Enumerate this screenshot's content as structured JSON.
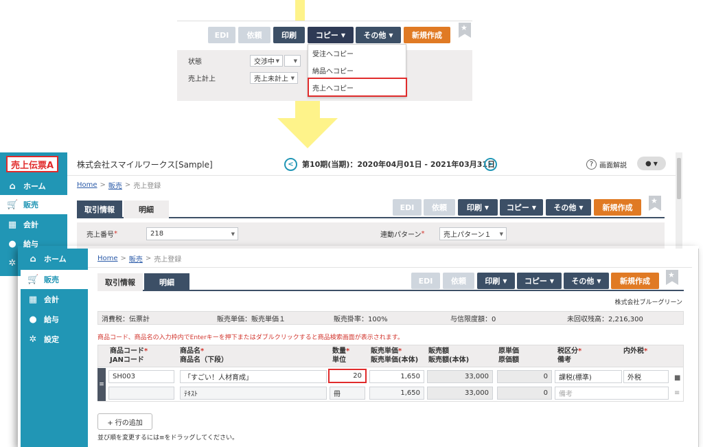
{
  "top_panel": {
    "buttons": {
      "edi": "EDI",
      "irai": "依頼",
      "print": "印刷",
      "copy": "コピー",
      "other": "その他",
      "new": "新規作成"
    },
    "status_label": "状態",
    "status_value": "交渉中",
    "sales_label": "売上計上",
    "sales_value": "売上未計上",
    "dropdown": [
      "受注へコピー",
      "納品へコピー",
      "売上へコピー"
    ]
  },
  "colors": {
    "accent_red": "#e02b2b",
    "arrow_yellow": "#fef38a",
    "sidebar": "#2196b5",
    "orange": "#e07a24",
    "navy": "#3c4f66"
  },
  "window1": {
    "badge": "売上伝票A",
    "company": "株式会社スマイルワークス[Sample]",
    "period": "第10期(当期)：2020年04月01日 - 2021年03月31日",
    "help": "画面解説",
    "breadcrumb": {
      "home": "Home",
      "sep": ">",
      "sales": "販売",
      "page": "売上登録"
    },
    "tabs": [
      "取引情報",
      "明細"
    ],
    "buttons": {
      "edi": "EDI",
      "irai": "依頼",
      "print": "印刷",
      "copy": "コピー",
      "other": "その他",
      "new": "新規作成"
    },
    "number_label": "売上番号",
    "number_value": "218",
    "pattern_label": "連動パターン",
    "pattern_value": "売上パターン１",
    "nav": [
      {
        "label": "ホーム",
        "icon": "home-icon"
      },
      {
        "label": "販売",
        "icon": "cart-icon"
      },
      {
        "label": "会計",
        "icon": "calculator-icon"
      },
      {
        "label": "給与",
        "icon": "money-bag-icon"
      },
      {
        "label": "設定",
        "icon": "gear-icon"
      }
    ]
  },
  "window2": {
    "nav": [
      {
        "label": "ホーム",
        "icon": "home-icon"
      },
      {
        "label": "販売",
        "icon": "cart-icon"
      },
      {
        "label": "会計",
        "icon": "calculator-icon"
      },
      {
        "label": "給与",
        "icon": "money-bag-icon"
      },
      {
        "label": "設定",
        "icon": "gear-icon"
      }
    ],
    "breadcrumb": {
      "home": "Home",
      "sep": ">",
      "sales": "販売",
      "page": "売上登録"
    },
    "tabs": [
      "取引情報",
      "明細"
    ],
    "buttons": {
      "edi": "EDI",
      "irai": "依頼",
      "print": "印刷",
      "copy": "コピー",
      "other": "その他",
      "new": "新規作成"
    },
    "customer": "株式会社ブルーグリーン",
    "info": {
      "tax": "消費税：伝票計",
      "price": "販売単価：販売単価１",
      "rate": "販売掛率：100%",
      "credit": "与信限度額：0",
      "balance": "未回収残高：2,216,300"
    },
    "notice": "商品コード、商品名の入力枠内でEnterキーを押下またはダブルクリックすると商品検索画面が表示されます。",
    "headers": {
      "code": "商品コード",
      "jan": "JANコード",
      "name": "商品名",
      "name2": "商品名（下段）",
      "qty": "数量",
      "unit": "単位",
      "price": "販売単価",
      "price2": "販売単価(本体)",
      "amount": "販売額",
      "amount2": "販売額(本体)",
      "cost": "原単価",
      "cost2": "原価額",
      "taxcls": "税区分",
      "memo": "備考",
      "inout": "内外税"
    },
    "row": {
      "code": "SH003",
      "name": "「すごい！人材育成」",
      "name2": "ﾃｷｽﾄ",
      "qty": "20",
      "unit": "冊",
      "price": "1,650",
      "price2": "1,650",
      "amount": "33,000",
      "amount2": "33,000",
      "cost": "0",
      "cost2": "0",
      "taxcls": "課税(標準)",
      "inout": "外税",
      "memo_placeholder": "備考"
    },
    "add_row": "+ 行の追加",
    "drag_hint": "並び順を変更するには≡をドラッグしてください。"
  }
}
